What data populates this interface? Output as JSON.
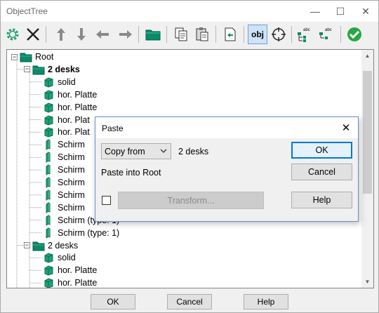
{
  "window": {
    "title": "ObjectTree",
    "minimize": "—",
    "maximize": "☐",
    "close": "✕"
  },
  "toolbar": {
    "items": [
      {
        "name": "settings",
        "icon": "gear-icon"
      },
      {
        "name": "delete",
        "icon": "cross-icon"
      },
      {
        "name": "move-up",
        "icon": "arrow-up-icon"
      },
      {
        "name": "move-down",
        "icon": "arrow-down-icon"
      },
      {
        "name": "move-left",
        "icon": "arrow-left-icon"
      },
      {
        "name": "move-right",
        "icon": "arrow-right-icon"
      },
      {
        "name": "open-folder",
        "icon": "folder-icon"
      },
      {
        "name": "copy",
        "icon": "copy-icon"
      },
      {
        "name": "paste",
        "icon": "paste-icon"
      },
      {
        "name": "insert",
        "icon": "insert-icon"
      },
      {
        "name": "obj",
        "icon": "obj-text-icon",
        "label": "obj",
        "active": true
      },
      {
        "name": "target",
        "icon": "crosshair-icon"
      },
      {
        "name": "tree-abc",
        "icon": "tree-abc-icon",
        "label": "abc"
      },
      {
        "name": "tree-abc-2",
        "icon": "tree-abc2-icon",
        "label": "abc"
      },
      {
        "name": "confirm",
        "icon": "check-icon"
      }
    ]
  },
  "tree": {
    "items": [
      {
        "label": "Root",
        "level": 0,
        "icon": "folder",
        "expander": "−",
        "bold": false
      },
      {
        "label": "2 desks",
        "level": 1,
        "icon": "folder",
        "expander": "−",
        "bold": true
      },
      {
        "label": "solid",
        "level": 2,
        "icon": "cube"
      },
      {
        "label": "hor. Platte",
        "level": 2,
        "icon": "cube"
      },
      {
        "label": "hor. Platte",
        "level": 2,
        "icon": "cube"
      },
      {
        "label": "hor. Plat",
        "level": 2,
        "icon": "cube"
      },
      {
        "label": "hor. Plat",
        "level": 2,
        "icon": "cube"
      },
      {
        "label": "Schirm",
        "level": 2,
        "icon": "panel"
      },
      {
        "label": "Schirm",
        "level": 2,
        "icon": "panel"
      },
      {
        "label": "Schirm",
        "level": 2,
        "icon": "panel"
      },
      {
        "label": "Schirm",
        "level": 2,
        "icon": "panel"
      },
      {
        "label": "Schirm",
        "level": 2,
        "icon": "panel"
      },
      {
        "label": "Schirm",
        "level": 2,
        "icon": "panel"
      },
      {
        "label": "Schirm (type: 1)",
        "level": 2,
        "icon": "panel"
      },
      {
        "label": "Schirm (type: 1)",
        "level": 2,
        "icon": "panel"
      },
      {
        "label": "2 desks",
        "level": 1,
        "icon": "folder",
        "expander": "−",
        "bold": false
      },
      {
        "label": "solid",
        "level": 2,
        "icon": "cube"
      },
      {
        "label": "hor. Platte",
        "level": 2,
        "icon": "cube"
      },
      {
        "label": "hor. Platte",
        "level": 2,
        "icon": "cube"
      }
    ]
  },
  "buttons": {
    "ok": "OK",
    "cancel": "Cancel",
    "help": "Help"
  },
  "dialog": {
    "title": "Paste",
    "close": "✕",
    "select_value": "Copy from",
    "source_name": "2 desks",
    "paste_target": "Paste into Root",
    "ok": "OK",
    "cancel": "Cancel",
    "help": "Help",
    "transform": "Transform...",
    "transform_checked": false
  },
  "colors": {
    "folder_green": "#0a8a6a",
    "cube_green": "#1aa37a",
    "accent_blue": "#0078d7"
  }
}
